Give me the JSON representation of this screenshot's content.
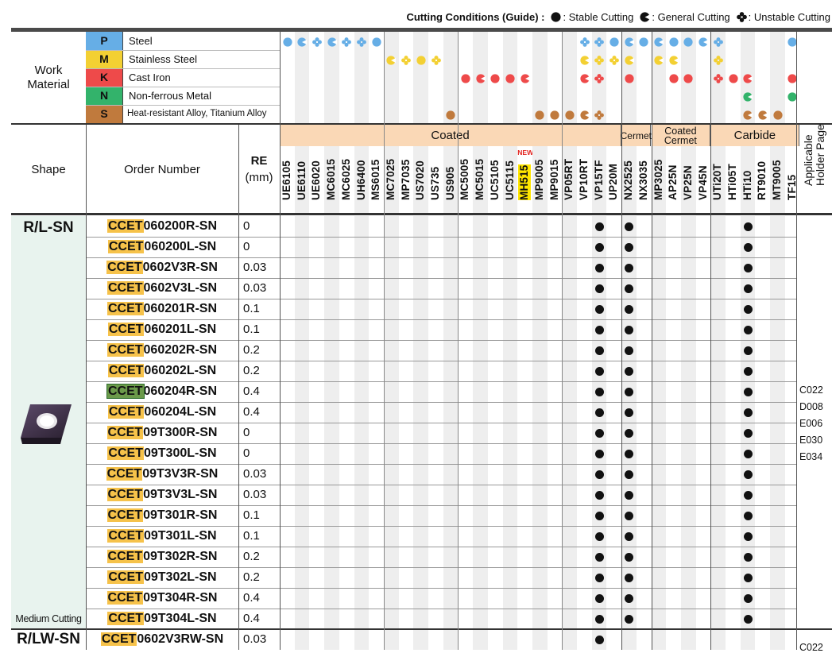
{
  "legend": {
    "title": "Cutting Conditions (Guide) :",
    "stable": ": Stable Cutting",
    "general": ": General Cutting",
    "unstable": ": Unstable Cutting"
  },
  "work_material": {
    "label": "Work Material",
    "rows": [
      {
        "letter": "P",
        "name": "Steel",
        "color": "#66aee6"
      },
      {
        "letter": "M",
        "name": "Stainless Steel",
        "color": "#f3d033"
      },
      {
        "letter": "K",
        "name": "Cast Iron",
        "color": "#ee4a4a"
      },
      {
        "letter": "N",
        "name": "Non-ferrous Metal",
        "color": "#33b36b"
      },
      {
        "letter": "S",
        "name": "Heat-resistant Alloy, Titanium Alloy",
        "color": "#c07a3d"
      }
    ]
  },
  "headers": {
    "shape": "Shape",
    "order_number": "Order Number",
    "re": "RE",
    "re_unit": "(mm)",
    "applicable": "Applicable Holder Page",
    "groups": [
      {
        "label": "Coated",
        "start": 0,
        "end": 23
      },
      {
        "label": "Cermet",
        "start": 23,
        "end": 25
      },
      {
        "label": "Coated Cermet",
        "start": 25,
        "end": 29
      },
      {
        "label": "Carbide",
        "start": 29,
        "end": 35
      }
    ],
    "new_badge": "NEW"
  },
  "grades": [
    "UE6105",
    "UE6110",
    "UE6020",
    "MC6015",
    "MC6025",
    "UH6400",
    "MS6015",
    "MC7025",
    "MP7035",
    "US7020",
    "US735",
    "US905",
    "MC5005",
    "MC5015",
    "UC5105",
    "UC5115",
    "MH515",
    "MP9005",
    "MP9015",
    "VP05RT",
    "VP10RT",
    "VP15TF",
    "UP20M",
    "NX2525",
    "NX3035",
    "MP3025",
    "AP25N",
    "VP25N",
    "VP45N",
    "UTi20T",
    "HTi05T",
    "HTi10",
    "RT9010",
    "MT9005",
    "TF15"
  ],
  "grade_marks": {
    "P": [
      [
        0,
        "s"
      ],
      [
        1,
        "g"
      ],
      [
        2,
        "u"
      ],
      [
        3,
        "g"
      ],
      [
        4,
        "u"
      ],
      [
        5,
        "u"
      ],
      [
        6,
        "s"
      ],
      [
        20,
        "u"
      ],
      [
        21,
        "u"
      ],
      [
        22,
        "s"
      ],
      [
        23,
        "g"
      ],
      [
        24,
        "s"
      ],
      [
        25,
        "g"
      ],
      [
        26,
        "s"
      ],
      [
        27,
        "s"
      ],
      [
        28,
        "g"
      ],
      [
        29,
        "u"
      ],
      [
        34,
        "s"
      ]
    ],
    "M": [
      [
        7,
        "g"
      ],
      [
        8,
        "u"
      ],
      [
        9,
        "s"
      ],
      [
        10,
        "u"
      ],
      [
        20,
        "g"
      ],
      [
        21,
        "u"
      ],
      [
        22,
        "u"
      ],
      [
        23,
        "g"
      ],
      [
        25,
        "g"
      ],
      [
        26,
        "g"
      ],
      [
        29,
        "u"
      ]
    ],
    "K": [
      [
        12,
        "s"
      ],
      [
        13,
        "g"
      ],
      [
        14,
        "s"
      ],
      [
        15,
        "s"
      ],
      [
        16,
        "g"
      ],
      [
        20,
        "g"
      ],
      [
        21,
        "u"
      ],
      [
        23,
        "s"
      ],
      [
        26,
        "s"
      ],
      [
        27,
        "s"
      ],
      [
        29,
        "u"
      ],
      [
        30,
        "s"
      ],
      [
        31,
        "g"
      ],
      [
        34,
        "s"
      ]
    ],
    "N": [
      [
        31,
        "g"
      ],
      [
        34,
        "s"
      ]
    ],
    "S": [
      [
        11,
        "s"
      ],
      [
        17,
        "s"
      ],
      [
        18,
        "s"
      ],
      [
        19,
        "s"
      ],
      [
        20,
        "g"
      ],
      [
        21,
        "u"
      ],
      [
        31,
        "g"
      ],
      [
        32,
        "g"
      ],
      [
        33,
        "s"
      ]
    ]
  },
  "sections": [
    {
      "shape_label": "R/L-SN",
      "caption": "Medium Cutting",
      "holder_pages": [
        "C022",
        "D008",
        "E006",
        "E030",
        "E034"
      ]
    },
    {
      "shape_label": "R/LW-SN",
      "holder_pages": [
        "C022"
      ]
    }
  ],
  "rows": [
    {
      "prefix": "CCET",
      "rest": "060200R-SN",
      "re": "0"
    },
    {
      "prefix": "CCET",
      "rest": "060200L-SN",
      "re": "0"
    },
    {
      "prefix": "CCET",
      "rest": "0602V3R-SN",
      "re": "0.03"
    },
    {
      "prefix": "CCET",
      "rest": "0602V3L-SN",
      "re": "0.03"
    },
    {
      "prefix": "CCET",
      "rest": "060201R-SN",
      "re": "0.1"
    },
    {
      "prefix": "CCET",
      "rest": "060201L-SN",
      "re": "0.1"
    },
    {
      "prefix": "CCET",
      "rest": "060202R-SN",
      "re": "0.2"
    },
    {
      "prefix": "CCET",
      "rest": "060202L-SN",
      "re": "0.2"
    },
    {
      "prefix": "CCET",
      "rest": "060204R-SN",
      "re": "0.4",
      "highlight": true
    },
    {
      "prefix": "CCET",
      "rest": "060204L-SN",
      "re": "0.4"
    },
    {
      "prefix": "CCET",
      "rest": "09T300R-SN",
      "re": "0"
    },
    {
      "prefix": "CCET",
      "rest": "09T300L-SN",
      "re": "0"
    },
    {
      "prefix": "CCET",
      "rest": "09T3V3R-SN",
      "re": "0.03"
    },
    {
      "prefix": "CCET",
      "rest": "09T3V3L-SN",
      "re": "0.03"
    },
    {
      "prefix": "CCET",
      "rest": "09T301R-SN",
      "re": "0.1"
    },
    {
      "prefix": "CCET",
      "rest": "09T301L-SN",
      "re": "0.1"
    },
    {
      "prefix": "CCET",
      "rest": "09T302R-SN",
      "re": "0.2"
    },
    {
      "prefix": "CCET",
      "rest": "09T302L-SN",
      "re": "0.2"
    },
    {
      "prefix": "CCET",
      "rest": "09T304R-SN",
      "re": "0.4"
    },
    {
      "prefix": "CCET",
      "rest": "09T304L-SN",
      "re": "0.4"
    },
    {
      "prefix": "CCET",
      "rest": "0602V3RW-SN",
      "re": "0.03",
      "section": 1
    }
  ],
  "stock_grades": {
    "rows_0_19": [
      21,
      23,
      31
    ],
    "row_20": [
      21
    ]
  }
}
